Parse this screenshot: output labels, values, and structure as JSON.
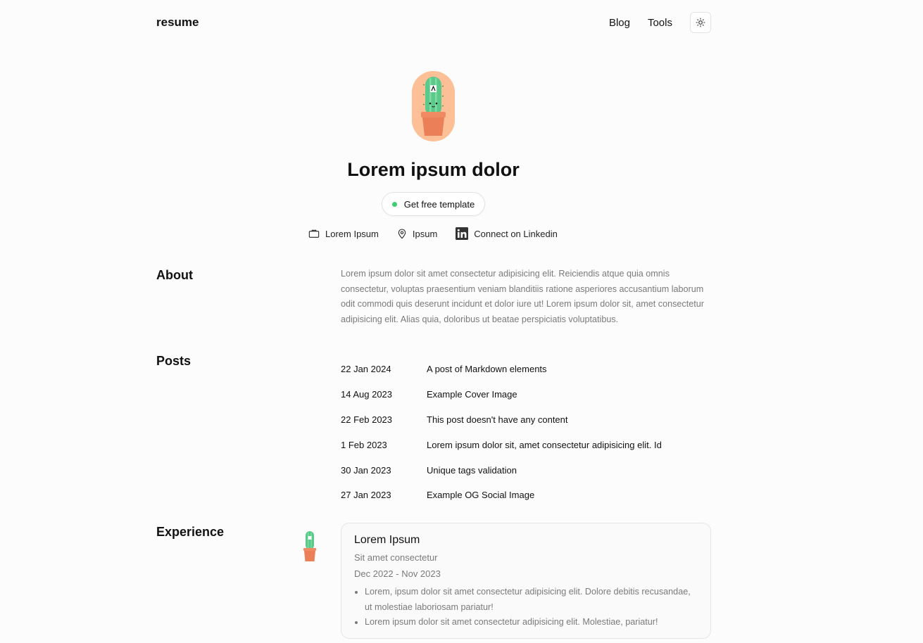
{
  "header": {
    "brand": "resume",
    "nav": [
      {
        "label": "Blog"
      },
      {
        "label": "Tools"
      }
    ],
    "theme_icon": "sun-icon"
  },
  "hero": {
    "avatar_icon": "cactus-avatar",
    "name": "Lorem ipsum dolor",
    "cta_label": "Get free template",
    "status_color": "#3ecf72",
    "meta": {
      "company": "Lorem Ipsum",
      "location": "Ipsum",
      "linkedin": "Connect on Linkedin"
    }
  },
  "about": {
    "title": "About",
    "text": "Lorem ipsum dolor sit amet consectetur adipisicing elit. Reiciendis atque quia omnis consectetur, voluptas praesentium veniam blanditiis ratione asperiores accusantium laborum odit commodi quis deserunt incidunt et dolor iure ut! Lorem ipsum dolor sit, amet consectetur adipisicing elit. Alias quia, doloribus ut beatae perspiciatis voluptatibus."
  },
  "posts": {
    "title": "Posts",
    "items": [
      {
        "date": "22 Jan 2024",
        "title": "A post of Markdown elements"
      },
      {
        "date": "14 Aug 2023",
        "title": "Example Cover Image"
      },
      {
        "date": "22 Feb 2023",
        "title": "This post doesn't have any content"
      },
      {
        "date": "1 Feb 2023",
        "title": "Lorem ipsum dolor sit, amet consectetur adipisicing elit. Id"
      },
      {
        "date": "30 Jan 2023",
        "title": "Unique tags validation"
      },
      {
        "date": "27 Jan 2023",
        "title": "Example OG Social Image"
      }
    ]
  },
  "experience": {
    "title": "Experience",
    "items": [
      {
        "company": "Lorem Ipsum",
        "role": "Sit amet consectetur",
        "dates": "Dec 2022 - Nov 2023",
        "bullets": [
          "Lorem, ipsum dolor sit amet consectetur adipisicing elit. Dolore debitis recusandae, ut molestiae laboriosam pariatur!",
          "Lorem ipsum dolor sit amet consectetur adipisicing elit. Molestiae, pariatur!"
        ]
      }
    ]
  }
}
